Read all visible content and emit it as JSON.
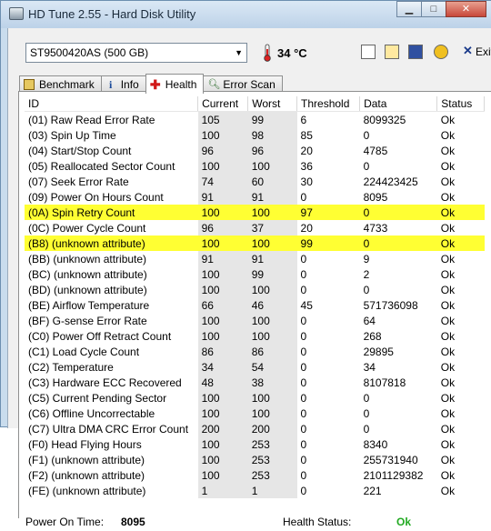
{
  "window": {
    "title": "HD Tune 2.55 - Hard Disk Utility"
  },
  "toolbar": {
    "drive": "ST9500420AS (500 GB)",
    "temperature": "34 °C",
    "exit_label": "Exit"
  },
  "tabs": [
    {
      "label": "Benchmark",
      "active": false
    },
    {
      "label": "Info",
      "active": false
    },
    {
      "label": "Health",
      "active": true
    },
    {
      "label": "Error Scan",
      "active": false
    }
  ],
  "table": {
    "headers": [
      "ID",
      "Current",
      "Worst",
      "Threshold",
      "Data",
      "Status"
    ],
    "rows": [
      [
        "(01) Raw Read Error Rate",
        "105",
        "99",
        "6",
        "8099325",
        "Ok"
      ],
      [
        "(03) Spin Up Time",
        "100",
        "98",
        "85",
        "0",
        "Ok"
      ],
      [
        "(04) Start/Stop Count",
        "96",
        "96",
        "20",
        "4785",
        "Ok"
      ],
      [
        "(05) Reallocated Sector Count",
        "100",
        "100",
        "36",
        "0",
        "Ok"
      ],
      [
        "(07) Seek Error Rate",
        "74",
        "60",
        "30",
        "224423425",
        "Ok"
      ],
      [
        "(09) Power On Hours Count",
        "91",
        "91",
        "0",
        "8095",
        "Ok"
      ],
      [
        "(0A) Spin Retry Count",
        "100",
        "100",
        "97",
        "0",
        "Ok"
      ],
      [
        "(0C) Power Cycle Count",
        "96",
        "37",
        "20",
        "4733",
        "Ok"
      ],
      [
        "(B8) (unknown attribute)",
        "100",
        "100",
        "99",
        "0",
        "Ok"
      ],
      [
        "(BB) (unknown attribute)",
        "91",
        "91",
        "0",
        "9",
        "Ok"
      ],
      [
        "(BC) (unknown attribute)",
        "100",
        "99",
        "0",
        "2",
        "Ok"
      ],
      [
        "(BD) (unknown attribute)",
        "100",
        "100",
        "0",
        "0",
        "Ok"
      ],
      [
        "(BE) Airflow Temperature",
        "66",
        "46",
        "45",
        "571736098",
        "Ok"
      ],
      [
        "(BF) G-sense Error Rate",
        "100",
        "100",
        "0",
        "64",
        "Ok"
      ],
      [
        "(C0) Power Off Retract Count",
        "100",
        "100",
        "0",
        "268",
        "Ok"
      ],
      [
        "(C1) Load Cycle Count",
        "86",
        "86",
        "0",
        "29895",
        "Ok"
      ],
      [
        "(C2) Temperature",
        "34",
        "54",
        "0",
        "34",
        "Ok"
      ],
      [
        "(C3) Hardware ECC Recovered",
        "48",
        "38",
        "0",
        "8107818",
        "Ok"
      ],
      [
        "(C5) Current Pending Sector",
        "100",
        "100",
        "0",
        "0",
        "Ok"
      ],
      [
        "(C6) Offline Uncorrectable",
        "100",
        "100",
        "0",
        "0",
        "Ok"
      ],
      [
        "(C7) Ultra DMA CRC Error Count",
        "200",
        "200",
        "0",
        "0",
        "Ok"
      ],
      [
        "(F0) Head Flying Hours",
        "100",
        "253",
        "0",
        "8340",
        "Ok"
      ],
      [
        "(F1) (unknown attribute)",
        "100",
        "253",
        "0",
        "255731940",
        "Ok"
      ],
      [
        "(F2) (unknown attribute)",
        "100",
        "253",
        "0",
        "2101129382",
        "Ok"
      ],
      [
        "(FE) (unknown attribute)",
        "1",
        "1",
        "0",
        "221",
        "Ok"
      ]
    ],
    "highlight_color": "#ffff33"
  },
  "footer": {
    "power_on_label": "Power On Time:",
    "power_on_value": "8095",
    "health_label": "Health Status:",
    "health_value": "Ok",
    "health_color": "#22aa22"
  }
}
